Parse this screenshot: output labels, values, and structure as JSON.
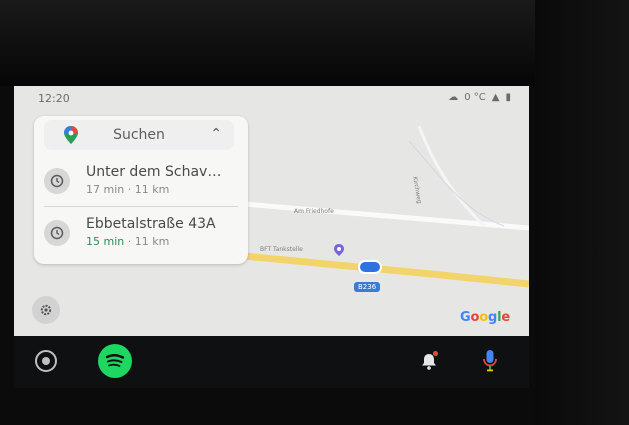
{
  "status_bar": {
    "time": "12:20",
    "temperature": "0 °C"
  },
  "search": {
    "label": "Suchen"
  },
  "recents": [
    {
      "title": "Unter dem Schav…",
      "duration": "17 min",
      "separator": " · ",
      "distance": "11 km"
    },
    {
      "title": "Ebbetalstraße 43A",
      "duration": "15 min",
      "separator": " · ",
      "distance": "11 km"
    }
  ],
  "map": {
    "labels": [
      "Am Friedhofe",
      "BFT Tankstelle",
      "Kirchweg"
    ],
    "route_badge": "B236",
    "google_letters": [
      "G",
      "o",
      "o",
      "g",
      "l",
      "e"
    ],
    "google_colors": [
      "#4285F4",
      "#EA4335",
      "#FBBC05",
      "#4285F4",
      "#34A853",
      "#EA4335"
    ]
  },
  "colors": {
    "route": "#2f73e0",
    "eta_green": "#2e8b57",
    "spotify": "#1ed760"
  },
  "dock": {
    "home_icon": "home-icon",
    "app_icon": "spotify-icon",
    "notif_icon": "bell-icon",
    "voice_icon": "mic-icon"
  }
}
